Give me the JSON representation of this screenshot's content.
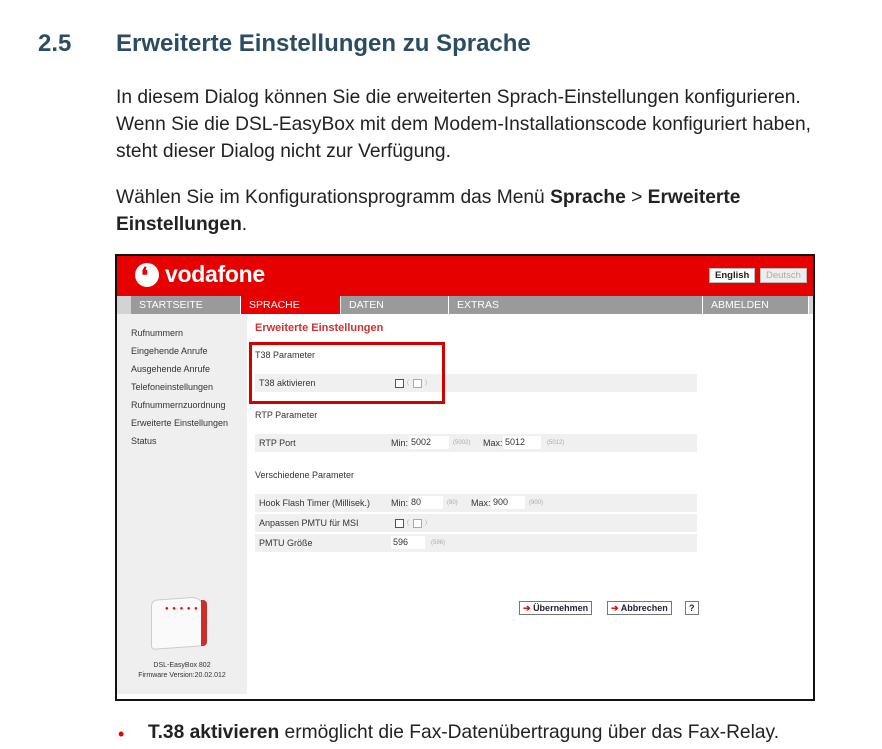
{
  "section": {
    "number": "2.5",
    "title": "Erweiterte Einstellungen zu Sprache"
  },
  "para1": "In diesem Dialog können Sie die erweiterten Sprach-Einstellungen konfigurieren. Wenn Sie die DSL-EasyBox mit dem Modem-Installationscode konfiguriert haben, steht dieser Dialog nicht zur Verfügung.",
  "para2": {
    "lead": "Wählen Sie im Konfigurationsprogramm das Menü ",
    "menu1": "Sprache",
    "sep": " > ",
    "menu2": "Erweiterte Einstellungen",
    "end": "."
  },
  "ui": {
    "brand": "vodafone",
    "lang_en": "English",
    "lang_de": "Deutsch",
    "nav": [
      "STARTSEITE",
      "SPRACHE",
      "DATEN",
      "EXTRAS",
      "ABMELDEN"
    ],
    "sidebar": [
      "Rufnummern",
      "Eingehende Anrufe",
      "Ausgehende Anrufe",
      "Telefoneinstellungen",
      "Rufnummernzuordnung",
      "Erweiterte Einstellungen",
      "Status"
    ],
    "device_name": "DSL-EasyBox 802",
    "firmware": "Firmware Version:20.02.012",
    "content_title": "Erweiterte Einstellungen",
    "t38": {
      "group": "T38 Parameter",
      "label": "T38 aktivieren"
    },
    "rtp": {
      "group": "RTP Parameter",
      "label": "RTP Port",
      "min_label": "Min:",
      "min_value": "5002",
      "min_default": "(5002)",
      "max_label": "Max:",
      "max_value": "5012",
      "max_default": "(5012)"
    },
    "misc": {
      "group": "Verschiedene Parameter",
      "hook_label": "Hook Flash Timer (Millisek.)",
      "hook_min_label": "Min:",
      "hook_min_value": "80",
      "hook_min_default": "(80)",
      "hook_max_label": "Max:",
      "hook_max_value": "900",
      "hook_max_default": "(900)",
      "pmtu_msi_label": "Anpassen PMTU für MSI",
      "pmtu_label": "PMTU Größe",
      "pmtu_value": "596",
      "pmtu_default": "(596)"
    },
    "buttons": {
      "apply": "Übernehmen",
      "cancel": "Abbrechen",
      "help": "?"
    }
  },
  "bullet": {
    "bold": "T.38 aktivieren",
    "rest": " ermöglicht die Fax-Datenübertragung über das Fax-Relay."
  },
  "colors": {
    "heading": "#2b4d63",
    "brand_red": "#e60000",
    "highlight": "#d40000"
  }
}
